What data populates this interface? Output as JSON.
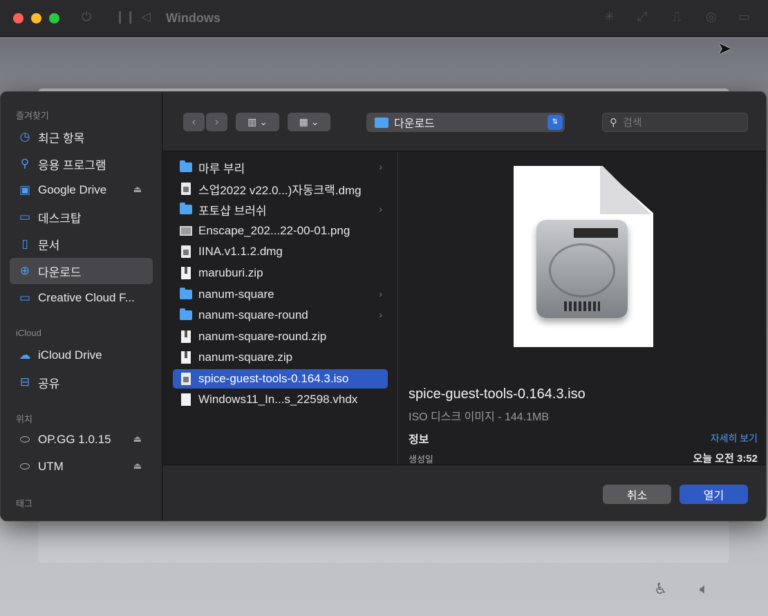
{
  "host": {
    "title": "Windows"
  },
  "sidebar": {
    "sections": [
      {
        "label": "즐겨찾기"
      },
      {
        "label": "iCloud"
      },
      {
        "label": "위치"
      },
      {
        "label": "태그"
      }
    ],
    "favorites": [
      {
        "label": "최근 항목",
        "icon": "clock-icon"
      },
      {
        "label": "응용 프로그램",
        "icon": "apps-icon"
      },
      {
        "label": "Google Drive",
        "icon": "drive-folder-icon"
      },
      {
        "label": "데스크탑",
        "icon": "desktop-icon"
      },
      {
        "label": "문서",
        "icon": "document-icon"
      },
      {
        "label": "다운로드",
        "icon": "download-icon"
      },
      {
        "label": "Creative Cloud F...",
        "icon": "folder-icon"
      }
    ],
    "icloud": [
      {
        "label": "iCloud Drive",
        "icon": "cloud-icon"
      },
      {
        "label": "공유",
        "icon": "shared-folder-icon"
      }
    ],
    "locations": [
      {
        "label": "OP.GG 1.0.15",
        "icon": "disk-icon"
      },
      {
        "label": "UTM",
        "icon": "disk-icon"
      }
    ]
  },
  "toolbar": {
    "location": "다운로드",
    "search_placeholder": "검색"
  },
  "files": [
    {
      "name": "마루 부리",
      "kind": "folder"
    },
    {
      "name": "스업2022 v22.0...)자동크랙.dmg",
      "kind": "doc"
    },
    {
      "name": "포토샵 브러쉬",
      "kind": "folder"
    },
    {
      "name": "Enscape_202...22-00-01.png",
      "kind": "img"
    },
    {
      "name": "IINA.v1.1.2.dmg",
      "kind": "doc"
    },
    {
      "name": "maruburi.zip",
      "kind": "zip"
    },
    {
      "name": "nanum-square",
      "kind": "folder"
    },
    {
      "name": "nanum-square-round",
      "kind": "folder"
    },
    {
      "name": "nanum-square-round.zip",
      "kind": "zip"
    },
    {
      "name": "nanum-square.zip",
      "kind": "zip"
    },
    {
      "name": "spice-guest-tools-0.164.3.iso",
      "kind": "doc"
    },
    {
      "name": "Windows11_In...s_22598.vhdx",
      "kind": "blank"
    }
  ],
  "preview": {
    "name": "spice-guest-tools-0.164.3.iso",
    "kind": "ISO 디스크 이미지 - 144.1MB",
    "info_label": "정보",
    "more_label": "자세히 보기",
    "created_label": "생성일",
    "created_value": "오늘 오전 3:52"
  },
  "buttons": {
    "cancel": "취소",
    "open": "열기"
  },
  "colors": {
    "accent": "#2f5ac4",
    "folder": "#4ea3f2"
  }
}
